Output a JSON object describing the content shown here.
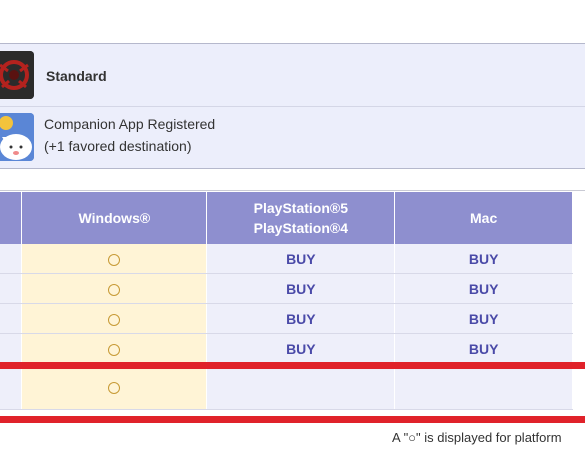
{
  "account": {
    "plan_label": "Standard",
    "plan_icon": "game-emblem-icon",
    "companion_line1": "Companion App Registered",
    "companion_line2": "(+1 favored destination)",
    "companion_icon": "moogle-icon"
  },
  "table": {
    "headers": [
      "",
      "Windows®",
      "PlayStation®5",
      "PlayStation®4",
      "Mac"
    ],
    "rows": [
      {
        "windows": "○",
        "playstation": "BUY",
        "mac": "BUY"
      },
      {
        "windows": "○",
        "playstation": "BUY",
        "mac": "BUY"
      },
      {
        "windows": "○",
        "playstation": "BUY",
        "mac": "BUY"
      },
      {
        "windows": "○",
        "playstation": "BUY",
        "mac": "BUY"
      },
      {
        "windows": "○",
        "playstation": "",
        "mac": ""
      }
    ]
  },
  "note": "A \"○\" is displayed for platform",
  "colors": {
    "header_bg": "#8e8fcf",
    "windows_cell_bg": "#fff4d6",
    "buy_text": "#4a4aa8",
    "highlight_bar": "#e0222a"
  }
}
